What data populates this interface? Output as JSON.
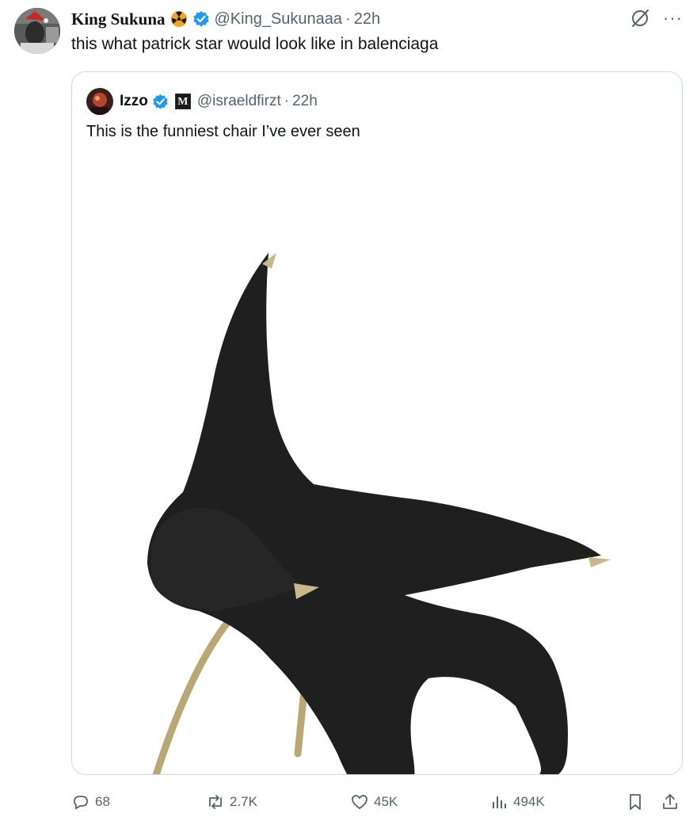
{
  "author": {
    "display_name": "King Sukuna",
    "handle": "@King_Sukunaaa",
    "time": "22h",
    "separator": "·",
    "text": "this what patrick star would look like in balenciaga"
  },
  "top_actions": {
    "more": "···"
  },
  "quoted": {
    "display_name": "Izzo",
    "affiliate_letter": "M",
    "handle": "@israeldfirzt",
    "time": "22h",
    "separator": "·",
    "text": "This is the funniest chair I’ve ever seen"
  },
  "actions": {
    "replies": "68",
    "reposts": "2.7K",
    "likes": "45K",
    "views": "494K"
  },
  "colors": {
    "verified": "#1d9bf0",
    "muted": "#536471",
    "border": "#cfd9de",
    "chair": "#1f1f1f",
    "brass": "#c8b88a"
  }
}
